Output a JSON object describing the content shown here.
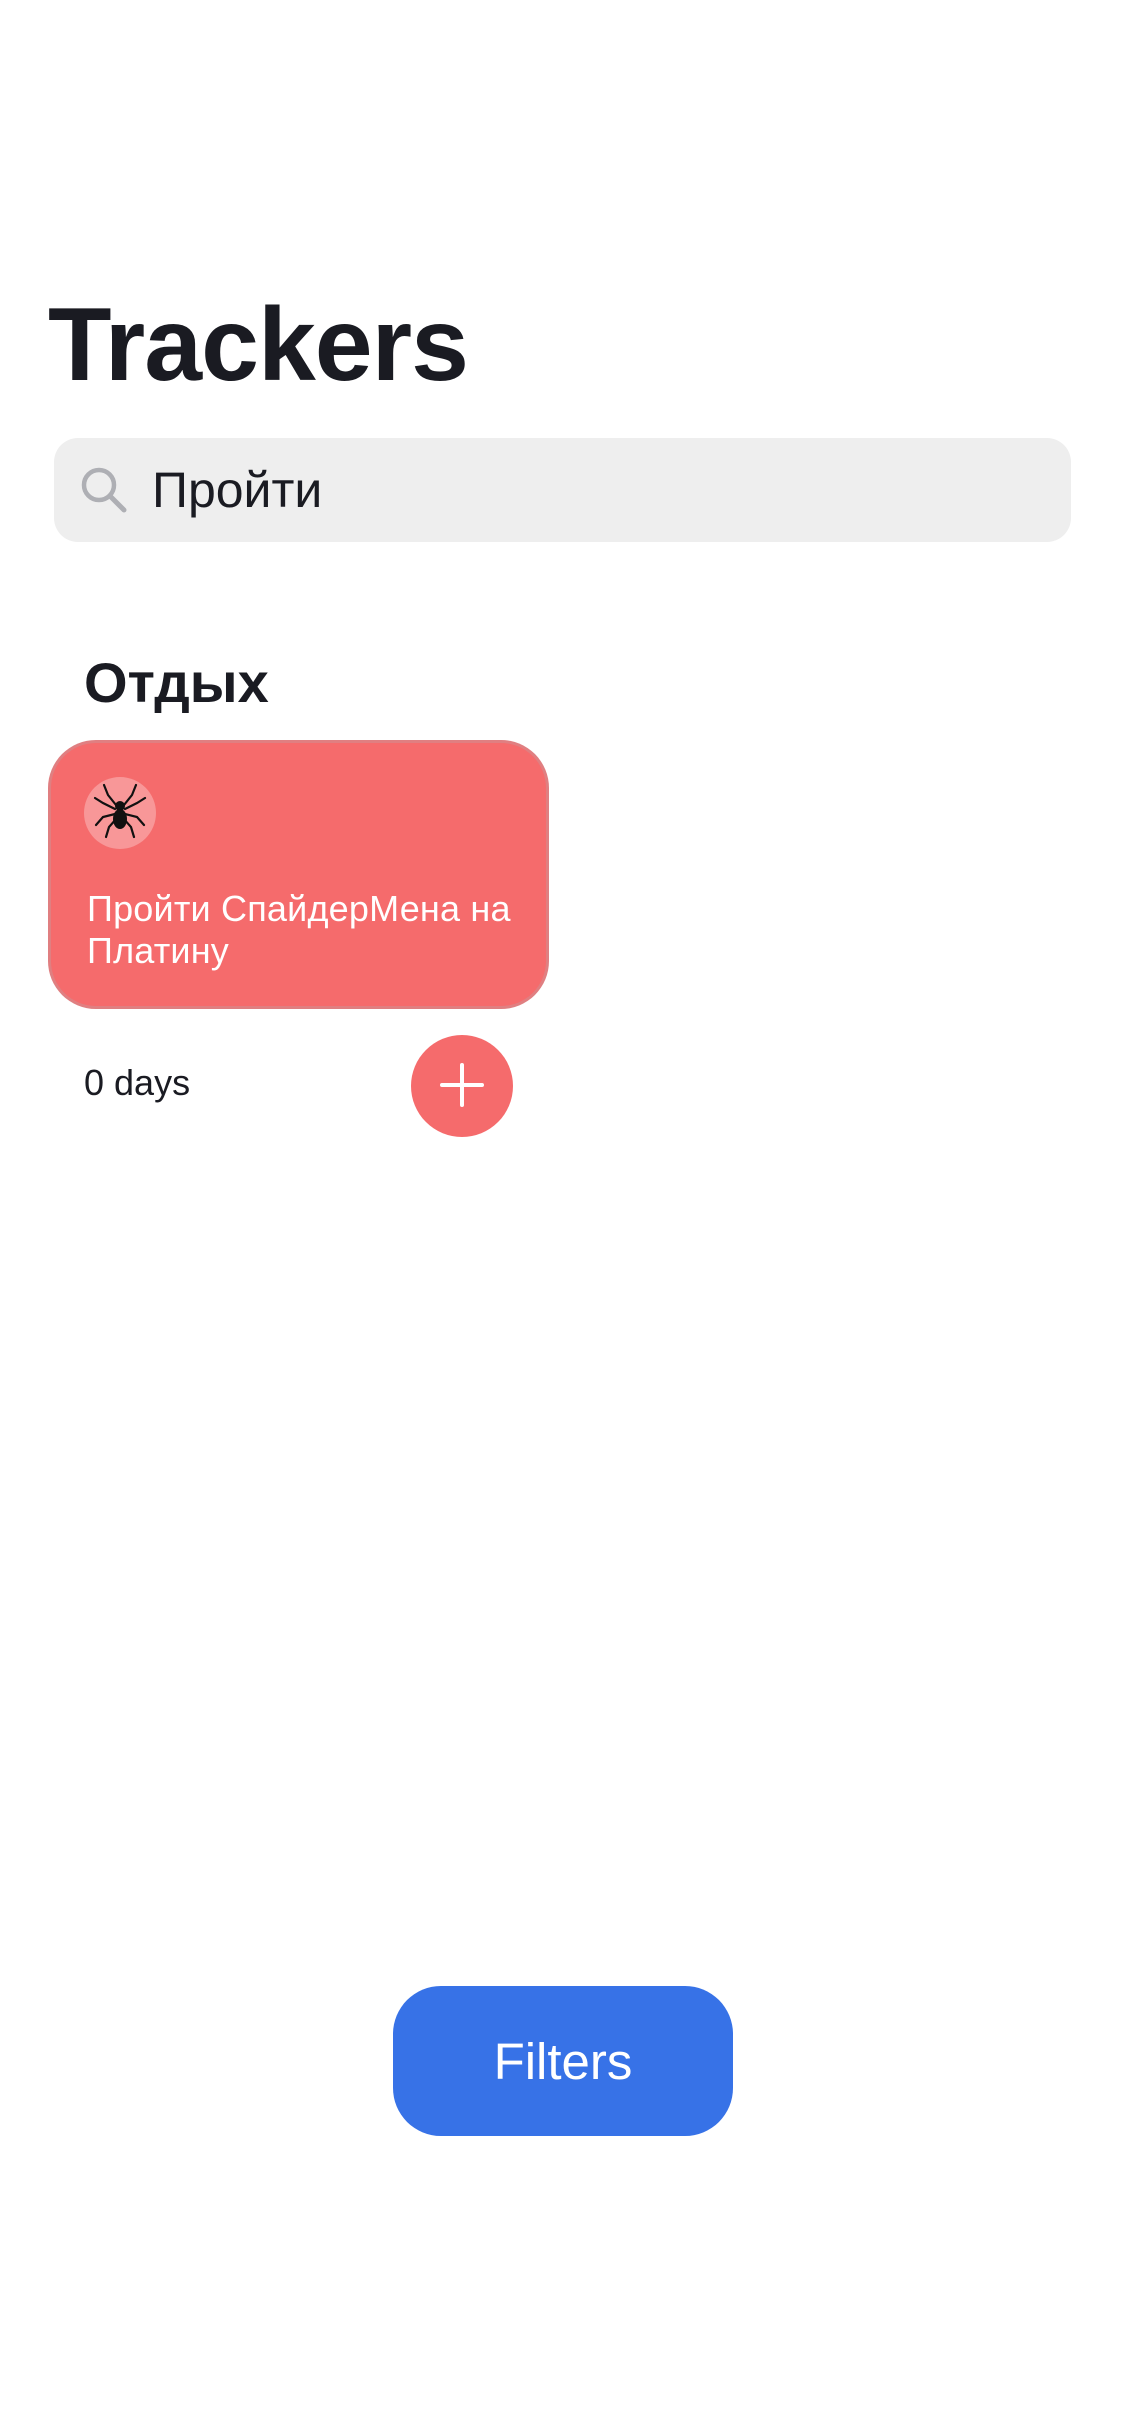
{
  "header": {
    "title": "Trackers"
  },
  "search": {
    "value": "Пройти",
    "icon": "magnifying-glass-icon"
  },
  "category": {
    "title": "Отдых",
    "trackers": [
      {
        "emoji": "🕷",
        "emoji_icon": "spider-icon",
        "name": "Пройти СпайдерМена на Платину",
        "days": "0 days",
        "color": "#F56B6C",
        "completed_today": false
      }
    ]
  },
  "filters": {
    "label": "Filters",
    "color": "#3772E7"
  },
  "colors": {
    "text_primary": "#1A1B22",
    "search_background": "#EEEEEE",
    "search_icon": "#AEAFB4"
  }
}
